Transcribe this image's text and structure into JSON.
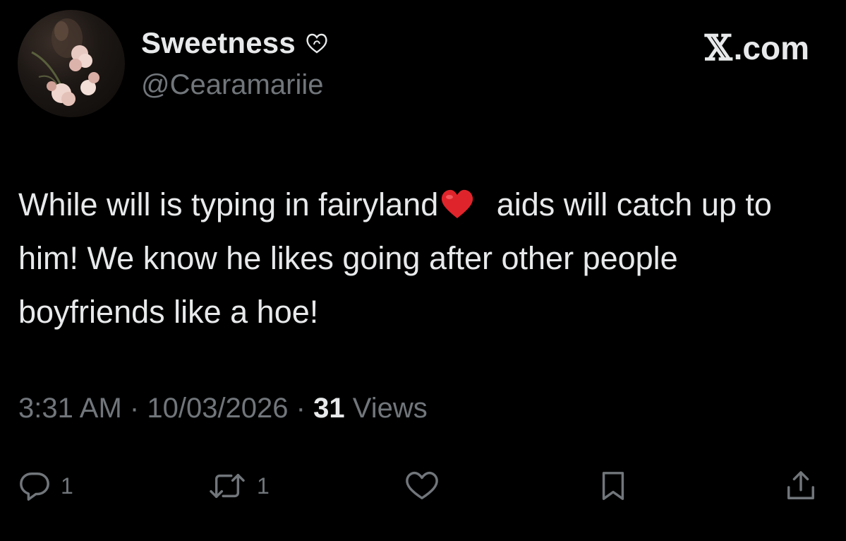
{
  "author": {
    "display_name": "Sweetness",
    "handle": "@Cearamariie",
    "badge_icon": "heart-outline-icon"
  },
  "source": {
    "x_glyph": "𝕏",
    "label": ".com"
  },
  "tweet": {
    "text_part_1": "While will is typing in fairyland",
    "emoji": "red-heart-emoji",
    "text_part_2": " aids will catch up to him! We know he likes going after other people boyfriends like a hoe!"
  },
  "meta": {
    "time": "3:31 AM",
    "separator": "·",
    "date": "10/03/2026",
    "views_count": "31",
    "views_label": "Views"
  },
  "actions": {
    "reply_count": "1",
    "retweet_count": "1",
    "icons": [
      "reply-icon",
      "retweet-icon",
      "like-icon",
      "bookmark-icon",
      "share-icon"
    ]
  },
  "colors": {
    "background": "#000000",
    "primary_text": "#e7e9ea",
    "secondary_text": "#71767b",
    "emoji_red": "#e0242b"
  }
}
